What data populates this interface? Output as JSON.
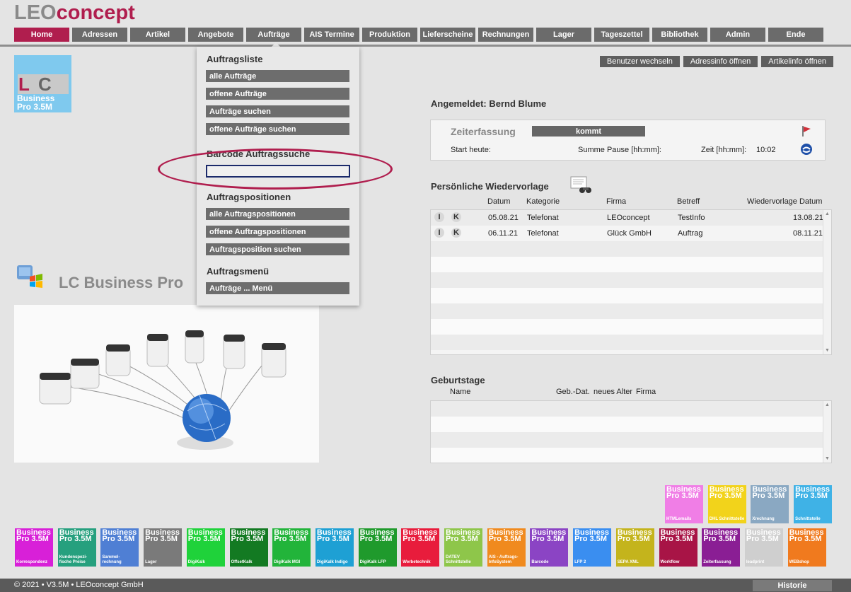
{
  "logo": {
    "part1": "LEO",
    "part2": "concept"
  },
  "nav": [
    {
      "label": "Home"
    },
    {
      "label": "Adressen"
    },
    {
      "label": "Artikel"
    },
    {
      "label": "Angebote"
    },
    {
      "label": "Aufträge"
    },
    {
      "label": "AIS Termine"
    },
    {
      "label": "Produktion"
    },
    {
      "label": "Lieferscheine"
    },
    {
      "label": "Rechnungen"
    },
    {
      "label": "Lager"
    },
    {
      "label": "Tageszettel"
    },
    {
      "label": "Bibliothek"
    },
    {
      "label": "Admin"
    },
    {
      "label": "Ende"
    }
  ],
  "colors": {
    "accent": "#b01e4e",
    "nav_bg": "#6b6b6b"
  },
  "top_actions": {
    "switch_user": "Benutzer wechseln",
    "address_info": "Adressinfo öffnen",
    "article_info": "Artikelinfo öffnen"
  },
  "small_logo": {
    "letters1": "L",
    "letters2": "C",
    "line1": "Business",
    "line2": "Pro 3.5M"
  },
  "brand_title": "LC Business Pro",
  "dropdown": {
    "section1": "Auftragsliste",
    "items1": [
      "alle Aufträge",
      "offene Aufträge",
      "Aufträge suchen",
      "offene Aufträge suchen"
    ],
    "section2": "Barcode Auftragssuche",
    "barcode_value": "",
    "section3": "Auftragspositionen",
    "items3": [
      "alle Auftragspositionen",
      "offene Auftragspositionen",
      "Auftragsposition suchen"
    ],
    "section4": "Auftragsmenü",
    "items4": [
      "Aufträge ... Menü"
    ]
  },
  "logged_in": "Angemeldet: Bernd Blume",
  "time_tracking": {
    "title": "Zeiterfassung",
    "button": "kommt",
    "start_label": "Start heute:",
    "pause_label": "Summe Pause [hh:mm]:",
    "time_label": "Zeit [hh:mm]:",
    "time_value": "10:02"
  },
  "resubmission": {
    "title": "Persönliche Wiedervorlage",
    "headers": [
      "Datum",
      "Kategorie",
      "Firma",
      "Betreff",
      "Wiedervorlage Datum"
    ],
    "rows": [
      {
        "i": "I",
        "k": "K",
        "date": "05.08.21",
        "category": "Telefonat",
        "company": "LEOconcept",
        "subject": "TestInfo",
        "due": "13.08.21"
      },
      {
        "i": "I",
        "k": "K",
        "date": "06.11.21",
        "category": "Telefonat",
        "company": "Glück GmbH",
        "subject": "Auftrag",
        "due": "08.11.21"
      }
    ]
  },
  "birthdays": {
    "title": "Geburtstage",
    "headers": [
      "Name",
      "Geb.-Dat.",
      "neues Alter",
      "Firma"
    ]
  },
  "tiles_top": [
    {
      "l1": "Business",
      "l2": "Pro 3.5M",
      "caption": "HTMLemails",
      "color": "#f07ee6"
    },
    {
      "l1": "Business",
      "l2": "Pro 3.5M",
      "caption": "DHL Schnittstelle",
      "color": "#f2d31b"
    },
    {
      "l1": "Business",
      "l2": "Pro 3.5M",
      "caption": "Xrechnung",
      "color": "#8aa8c2"
    },
    {
      "l1": "Business",
      "l2": "Pro 3.5M",
      "caption": "Schnittstelle",
      "color": "#3fb2e6"
    }
  ],
  "tiles_bottom": [
    {
      "l1": "Business",
      "l2": "Pro 3.5M",
      "caption": "Korrespondenz",
      "color": "#d820d8"
    },
    {
      "l1": "Business",
      "l2": "Pro 3.5M",
      "caption": "Kundenspezi- fische Preise",
      "color": "#26a07e"
    },
    {
      "l1": "Business",
      "l2": "Pro 3.5M",
      "caption": "Sammel- rechnung",
      "color": "#4f7fd4"
    },
    {
      "l1": "Business",
      "l2": "Pro 3.5M",
      "caption": "Lager",
      "color": "#7a7a7a"
    },
    {
      "l1": "Business",
      "l2": "Pro 3.5M",
      "caption": "DigiKalk",
      "color": "#1fd23a"
    },
    {
      "l1": "Business",
      "l2": "Pro 3.5M",
      "caption": "OffsetKalk",
      "color": "#137a22"
    },
    {
      "l1": "Business",
      "l2": "Pro 3.5M",
      "caption": "DigiKalk MGI",
      "color": "#22b43a"
    },
    {
      "l1": "Business",
      "l2": "Pro 3.5M",
      "caption": "DigiKalk Indigo",
      "color": "#1ea0d4"
    },
    {
      "l1": "Business",
      "l2": "Pro 3.5M",
      "caption": "DigiKalk LFP",
      "color": "#1f9a2c"
    },
    {
      "l1": "Business",
      "l2": "Pro 3.5M",
      "caption": "Werbetechnik",
      "color": "#e81c3c"
    },
    {
      "l1": "Business",
      "l2": "Pro 3.5M",
      "caption": "DATEV Schnittstelle",
      "color": "#8ec64a"
    },
    {
      "l1": "Business",
      "l2": "Pro 3.5M",
      "caption": "AIS - Auftrags- InfoSystem",
      "color": "#f08a1e"
    },
    {
      "l1": "Business",
      "l2": "Pro 3.5M",
      "caption": "Barcode",
      "color": "#8b44c4"
    },
    {
      "l1": "Business",
      "l2": "Pro 3.5M",
      "caption": "LFP 2",
      "color": "#3a8ef0"
    },
    {
      "l1": "Business",
      "l2": "Pro 3.5M",
      "caption": "SEPA XML",
      "color": "#c4b41c"
    },
    {
      "l1": "Business",
      "l2": "Pro 3.5M",
      "caption": "Workflow",
      "color": "#a81446"
    },
    {
      "l1": "Business",
      "l2": "Pro 3.5M",
      "caption": "Zeiterfassung",
      "color": "#8a1e94"
    },
    {
      "l1": "Business",
      "l2": "Pro 3.5M",
      "caption": "leadprint",
      "color": "#cfcfcf"
    },
    {
      "l1": "Business",
      "l2": "Pro 3.5M",
      "caption": "WEBshop",
      "color": "#f07a1e"
    }
  ],
  "footer": {
    "copyright": "© 2021 • V3.5M • LEOconcept GmbH",
    "history": "Historie"
  }
}
